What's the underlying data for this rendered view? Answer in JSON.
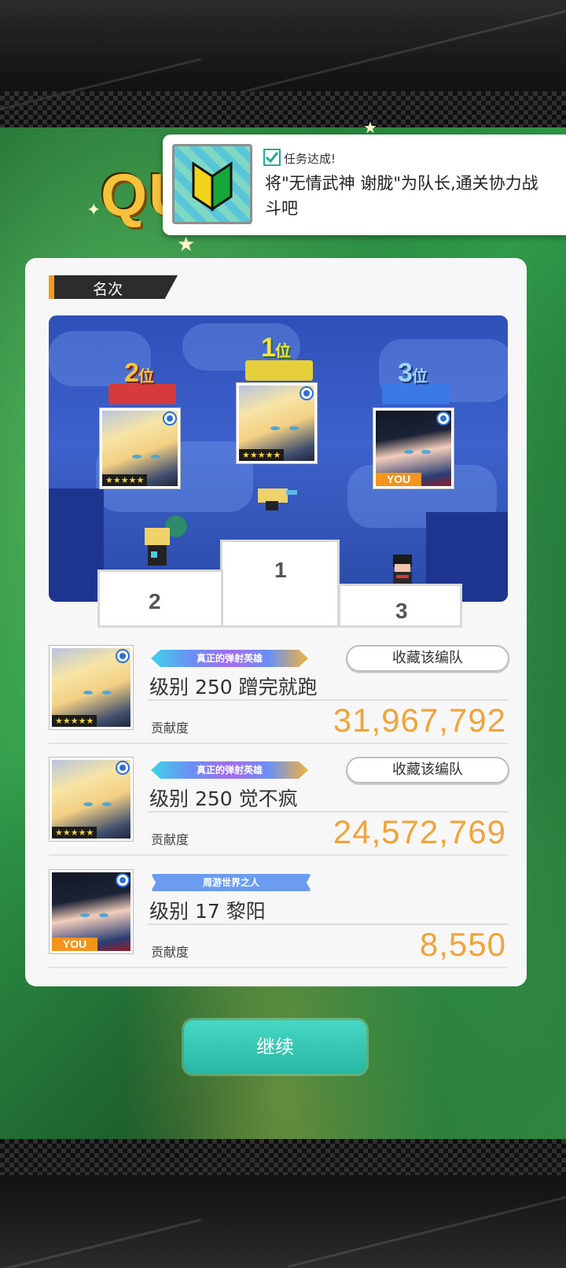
{
  "quest_logo": "QU",
  "mission": {
    "status": "任务达成!",
    "text": "将\"无情武神 谢胧\"为队长,通关协力战斗吧"
  },
  "ranking": {
    "section_title": "名次",
    "podium": [
      {
        "rank_label": "1",
        "rank_suffix": "位",
        "block_number": "1",
        "ribbon_color": "#ecd33b",
        "stars": "★★★★★"
      },
      {
        "rank_label": "2",
        "rank_suffix": "位",
        "block_number": "2",
        "ribbon_color": "#d63a3a",
        "stars": "★★★★★"
      },
      {
        "rank_label": "3",
        "rank_suffix": "位",
        "block_number": "3",
        "ribbon_color": "#3a78e6",
        "you": "YOU"
      }
    ]
  },
  "results": [
    {
      "title": "真正的弹射英雄",
      "save_label": "收藏该编队",
      "player": "级别 250 蹭完就跑",
      "contrib_label": "贡献度",
      "contrib": "31,967,792",
      "stars": "★★★★★"
    },
    {
      "title": "真正的弹射英雄",
      "save_label": "收藏该编队",
      "player": "级别 250 觉不疯",
      "contrib_label": "贡献度",
      "contrib": "24,572,769",
      "stars": "★★★★★"
    },
    {
      "title": "周游世界之人",
      "player": "级别 17 黎阳",
      "contrib_label": "贡献度",
      "contrib": "8,550",
      "you": "YOU"
    }
  ],
  "continue_label": "继续",
  "colors": {
    "accent_orange": "#f39a1d",
    "contrib_orange": "#f1a43a",
    "continue_teal": "#2fc3ae"
  }
}
